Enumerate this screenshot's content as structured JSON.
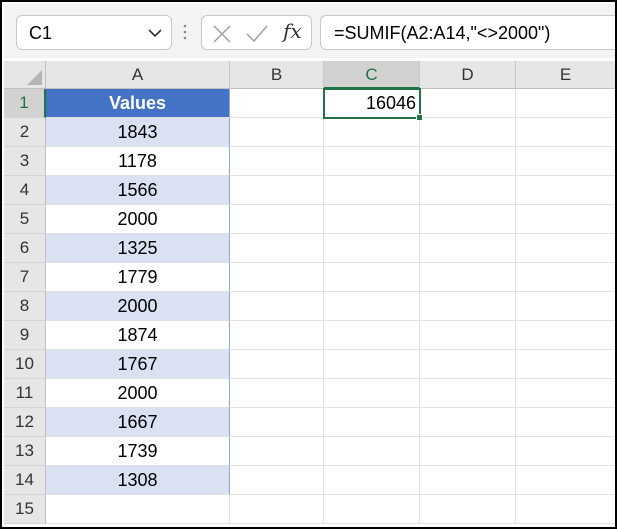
{
  "formula_bar": {
    "name_box": "C1",
    "formula": "=SUMIF(A2:A14,\"<>2000\")"
  },
  "icons": {
    "name_box_dropdown": "chevron-down-icon",
    "more": "vertical-dots-icon",
    "cancel": "close-icon",
    "enter": "checkmark-icon",
    "function": "fx-icon"
  },
  "grid": {
    "columns": [
      "A",
      "B",
      "C",
      "D",
      "E"
    ],
    "rows": [
      "1",
      "2",
      "3",
      "4",
      "5",
      "6",
      "7",
      "8",
      "9",
      "10",
      "11",
      "12",
      "13",
      "14",
      "15"
    ],
    "active_cell": "C1",
    "column_a": [
      "Values",
      "1843",
      "1178",
      "1566",
      "2000",
      "1325",
      "1779",
      "2000",
      "1874",
      "1767",
      "2000",
      "1667",
      "1739",
      "1308",
      ""
    ],
    "c1_value": "16046"
  },
  "colors": {
    "table_header": "#4472c4",
    "table_band": "#d9e1f2",
    "selection": "#217346"
  }
}
